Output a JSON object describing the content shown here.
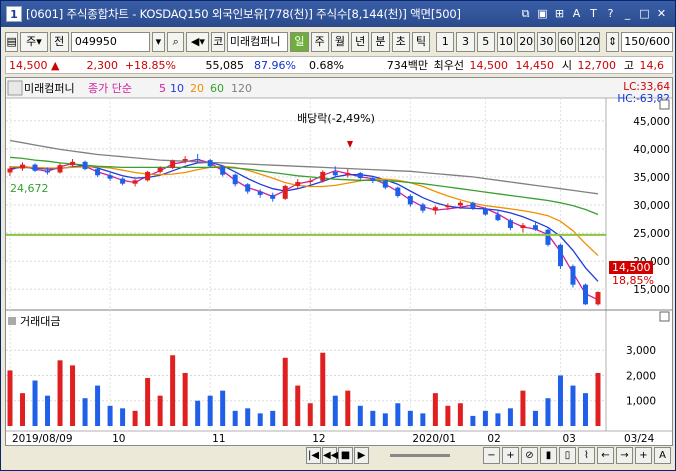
{
  "window": {
    "index": "1",
    "title": "[0601] 주식종합차트 - KOSDAQ150 외국인보유[778(천)] 주식수[8,144(천)] 액면[500]",
    "icons": [
      "link-icon",
      "save-icon",
      "grid-icon",
      "font-icon",
      "help-icon",
      "pin-icon",
      "minimize-icon",
      "maximize-icon",
      "close-icon"
    ]
  },
  "toolbar": {
    "market": "주",
    "prefix": "전",
    "code": "049950",
    "code_label": "코",
    "name": "미래컴퍼니",
    "periods": [
      "일",
      "주",
      "월",
      "년",
      "분",
      "초",
      "틱"
    ],
    "active_period": "일",
    "intervals": [
      "1",
      "3",
      "5",
      "10",
      "20",
      "30",
      "60",
      "120"
    ],
    "count": "150",
    "count_total": "/600"
  },
  "quote": {
    "price": "14,500",
    "change": "2,300",
    "change_pct": "+18.85%",
    "volume": "55,085",
    "vol_ratio": "87.96%",
    "turnover": "0.68%",
    "amount": "734백만",
    "preferred_label": "최우선",
    "ask": "14,500",
    "bid": "14,450",
    "open_label": "시",
    "open": "12,700",
    "high_label": "고",
    "high": "14,6"
  },
  "legend": {
    "name": "미래컴퍼니",
    "series_label": "종가 단순",
    "ma_periods": [
      "5",
      "10",
      "20",
      "60",
      "120"
    ],
    "lc": "LC:33,64",
    "hc": "HC:-63,82",
    "dividend_note": "배당락(-2,49%)",
    "hline_label": "24,672",
    "price_tag": "14,500",
    "price_pct": "18,85%",
    "volume_title": "거래대금"
  },
  "chart_data": {
    "type": "line",
    "price_axis": [
      "45,000",
      "40,000",
      "35,000",
      "30,000",
      "25,000",
      "20,000",
      "15,000"
    ],
    "price_ticks": [
      45000,
      40000,
      35000,
      30000,
      25000,
      20000,
      15000
    ],
    "volume_axis": [
      "3,000",
      "2,000",
      "1,000"
    ],
    "volume_ticks": [
      3000,
      2000,
      1000
    ],
    "x_labels": [
      "2019/08/09",
      "10",
      "11",
      "12",
      "2020/01",
      "02",
      "03",
      "03/24"
    ],
    "price_line": 24672,
    "ylim_price": [
      12000,
      48000
    ],
    "ylim_volume": [
      0,
      3800
    ],
    "series": [
      {
        "name": "5",
        "color": "#d01fa0",
        "values": [
          36200,
          37000,
          36400,
          36000,
          36800,
          37400,
          36900,
          35900,
          35200,
          34400,
          34000,
          35200,
          36100,
          37300,
          37700,
          38100,
          37500,
          36100,
          34400,
          33100,
          32400,
          31500,
          32600,
          33800,
          34200,
          35300,
          36100,
          35600,
          35000,
          34700,
          33700,
          32400,
          30900,
          29700,
          29100,
          29300,
          29600,
          30000,
          29400,
          28400,
          27100,
          26100,
          25700,
          24700,
          21700,
          17900,
          14200,
          13100
        ]
      },
      {
        "name": "10",
        "color": "#1e3cd8",
        "values": [
          36500,
          36700,
          36600,
          36400,
          36500,
          36800,
          37000,
          36600,
          35900,
          35200,
          34800,
          34900,
          35300,
          36100,
          36900,
          37500,
          37600,
          37000,
          35900,
          34700,
          33700,
          32900,
          32500,
          32900,
          33500,
          34200,
          35000,
          35400,
          35400,
          35100,
          34500,
          33700,
          32500,
          31300,
          30400,
          29800,
          29500,
          29400,
          29300,
          29100,
          28600,
          27900,
          27000,
          26000,
          24400,
          21900,
          18800,
          16400
        ]
      },
      {
        "name": "20",
        "color": "#f09000",
        "values": [
          36800,
          36800,
          36700,
          36600,
          36600,
          36700,
          36800,
          36800,
          36600,
          36200,
          35800,
          35500,
          35400,
          35500,
          35800,
          36300,
          36700,
          36900,
          36700,
          36200,
          35500,
          34800,
          34000,
          33500,
          33300,
          33300,
          33500,
          33900,
          34300,
          34600,
          34600,
          34400,
          34000,
          33300,
          32400,
          31600,
          30900,
          30300,
          29900,
          29600,
          29300,
          29000,
          28600,
          28100,
          27100,
          25400,
          23100,
          21000
        ]
      },
      {
        "name": "60",
        "color": "#38a030",
        "values": [
          38500,
          38300,
          38000,
          37800,
          37500,
          37300,
          37100,
          36900,
          36800,
          36700,
          36700,
          36700,
          36700,
          36700,
          36700,
          36700,
          36700,
          36700,
          36600,
          36400,
          36100,
          35800,
          35500,
          35200,
          35000,
          34800,
          34600,
          34500,
          34400,
          34400,
          34300,
          34200,
          34000,
          33800,
          33500,
          33200,
          32900,
          32600,
          32300,
          32000,
          31700,
          31400,
          31100,
          30800,
          30400,
          29900,
          29200,
          28300
        ]
      },
      {
        "name": "120",
        "color": "#808080",
        "values": [
          41500,
          41100,
          40700,
          40300,
          39900,
          39600,
          39300,
          39000,
          38800,
          38600,
          38400,
          38200,
          38000,
          37900,
          37800,
          37700,
          37600,
          37500,
          37400,
          37300,
          37200,
          37100,
          37000,
          36900,
          36800,
          36700,
          36600,
          36500,
          36400,
          36300,
          36200,
          36100,
          36000,
          35800,
          35600,
          35400,
          35200,
          35000,
          34700,
          34400,
          34100,
          33800,
          33500,
          33200,
          32900,
          32600,
          32300,
          32000
        ]
      }
    ],
    "candles": [
      [
        35800,
        36900,
        35200,
        36500
      ],
      [
        36500,
        37600,
        36100,
        37200
      ],
      [
        37200,
        37400,
        35900,
        36100
      ],
      [
        36100,
        36700,
        35400,
        35800
      ],
      [
        35800,
        37400,
        35600,
        37100
      ],
      [
        37100,
        38200,
        36800,
        37700
      ],
      [
        37700,
        37900,
        36200,
        36400
      ],
      [
        36400,
        36600,
        35000,
        35300
      ],
      [
        35300,
        35700,
        34300,
        34700
      ],
      [
        34700,
        34900,
        33500,
        33800
      ],
      [
        33800,
        34600,
        33300,
        34400
      ],
      [
        34400,
        36100,
        34200,
        35900
      ],
      [
        35900,
        36900,
        35600,
        36600
      ],
      [
        36600,
        38100,
        36400,
        37900
      ],
      [
        37900,
        38700,
        37400,
        38200
      ],
      [
        38200,
        39100,
        37700,
        38000
      ],
      [
        38000,
        38200,
        36700,
        36900
      ],
      [
        36900,
        37100,
        35100,
        35400
      ],
      [
        35400,
        35600,
        33300,
        33700
      ],
      [
        33700,
        33900,
        32000,
        32400
      ],
      [
        32400,
        32800,
        31300,
        31800
      ],
      [
        31800,
        32200,
        30600,
        31100
      ],
      [
        31100,
        33600,
        30900,
        33400
      ],
      [
        33400,
        34600,
        32900,
        34100
      ],
      [
        34100,
        34800,
        33600,
        34300
      ],
      [
        34300,
        36200,
        34000,
        35900
      ],
      [
        35900,
        36900,
        35100,
        35300
      ],
      [
        35300,
        36400,
        34900,
        35700
      ],
      [
        35700,
        35900,
        34500,
        34800
      ],
      [
        34800,
        35100,
        33900,
        34300
      ],
      [
        34300,
        34500,
        32800,
        33100
      ],
      [
        33100,
        33300,
        31300,
        31600
      ],
      [
        31600,
        31900,
        29700,
        30100
      ],
      [
        30100,
        30400,
        28600,
        29000
      ],
      [
        29000,
        29900,
        28300,
        29600
      ],
      [
        29600,
        30300,
        29100,
        29900
      ],
      [
        29900,
        30700,
        29300,
        30400
      ],
      [
        30400,
        30600,
        29100,
        29400
      ],
      [
        29400,
        29600,
        28100,
        28300
      ],
      [
        28300,
        28900,
        27100,
        27300
      ],
      [
        27300,
        27600,
        25500,
        25900
      ],
      [
        25900,
        26800,
        25100,
        26400
      ],
      [
        26400,
        27100,
        25400,
        25600
      ],
      [
        25600,
        25800,
        22600,
        22900
      ],
      [
        22900,
        23100,
        18600,
        19100
      ],
      [
        19100,
        19400,
        15300,
        15800
      ],
      [
        15800,
        16000,
        12200,
        12300
      ],
      [
        12300,
        14600,
        12100,
        14500
      ]
    ],
    "volumes": [
      2200,
      1300,
      1800,
      1200,
      2600,
      2400,
      1100,
      1600,
      800,
      700,
      600,
      1900,
      1200,
      2800,
      2100,
      1000,
      1200,
      1400,
      600,
      700,
      500,
      600,
      2700,
      1600,
      900,
      2900,
      1200,
      1400,
      800,
      600,
      500,
      900,
      600,
      500,
      1300,
      800,
      900,
      400,
      600,
      500,
      700,
      1400,
      600,
      1100,
      2000,
      1600,
      1300,
      2100
    ],
    "volume_up": [
      true,
      true,
      false,
      false,
      true,
      true,
      false,
      false,
      false,
      false,
      true,
      true,
      true,
      true,
      true,
      false,
      false,
      false,
      false,
      false,
      false,
      false,
      true,
      true,
      true,
      true,
      false,
      true,
      false,
      false,
      false,
      false,
      false,
      false,
      true,
      true,
      true,
      false,
      false,
      false,
      false,
      true,
      false,
      false,
      false,
      false,
      false,
      true
    ]
  }
}
